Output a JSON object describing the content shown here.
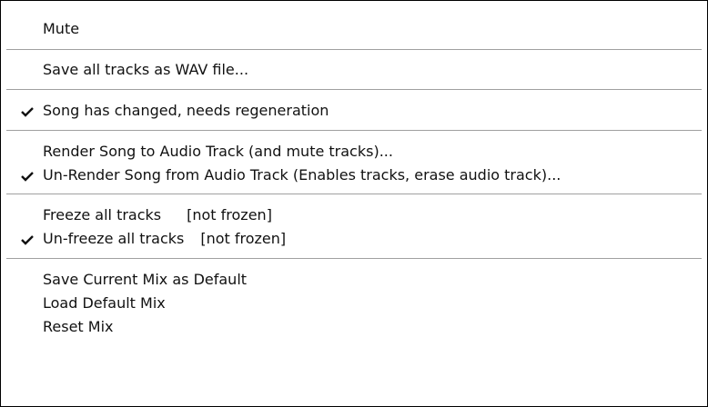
{
  "menu": {
    "mute": "Mute",
    "save_wav": "Save all tracks as WAV file...",
    "song_changed": "Song has changed, needs regeneration",
    "render_song": "Render Song to Audio Track (and mute tracks)...",
    "unrender_song": "Un-Render Song from Audio Track (Enables tracks, erase audio track)...",
    "freeze_label": "Freeze all tracks",
    "freeze_status": "[not frozen]",
    "unfreeze_label": "Un-freeze all tracks",
    "unfreeze_status": "[not frozen]",
    "save_mix": "Save Current Mix as Default",
    "load_mix": "Load Default Mix",
    "reset_mix": "Reset Mix"
  },
  "checked": {
    "song_changed": true,
    "unrender_song": true,
    "unfreeze": true
  },
  "icons": {
    "check": "check-icon"
  },
  "colors": {
    "text": "#111111",
    "separator": "#a0a0a0",
    "border": "#000000",
    "background": "#ffffff"
  }
}
